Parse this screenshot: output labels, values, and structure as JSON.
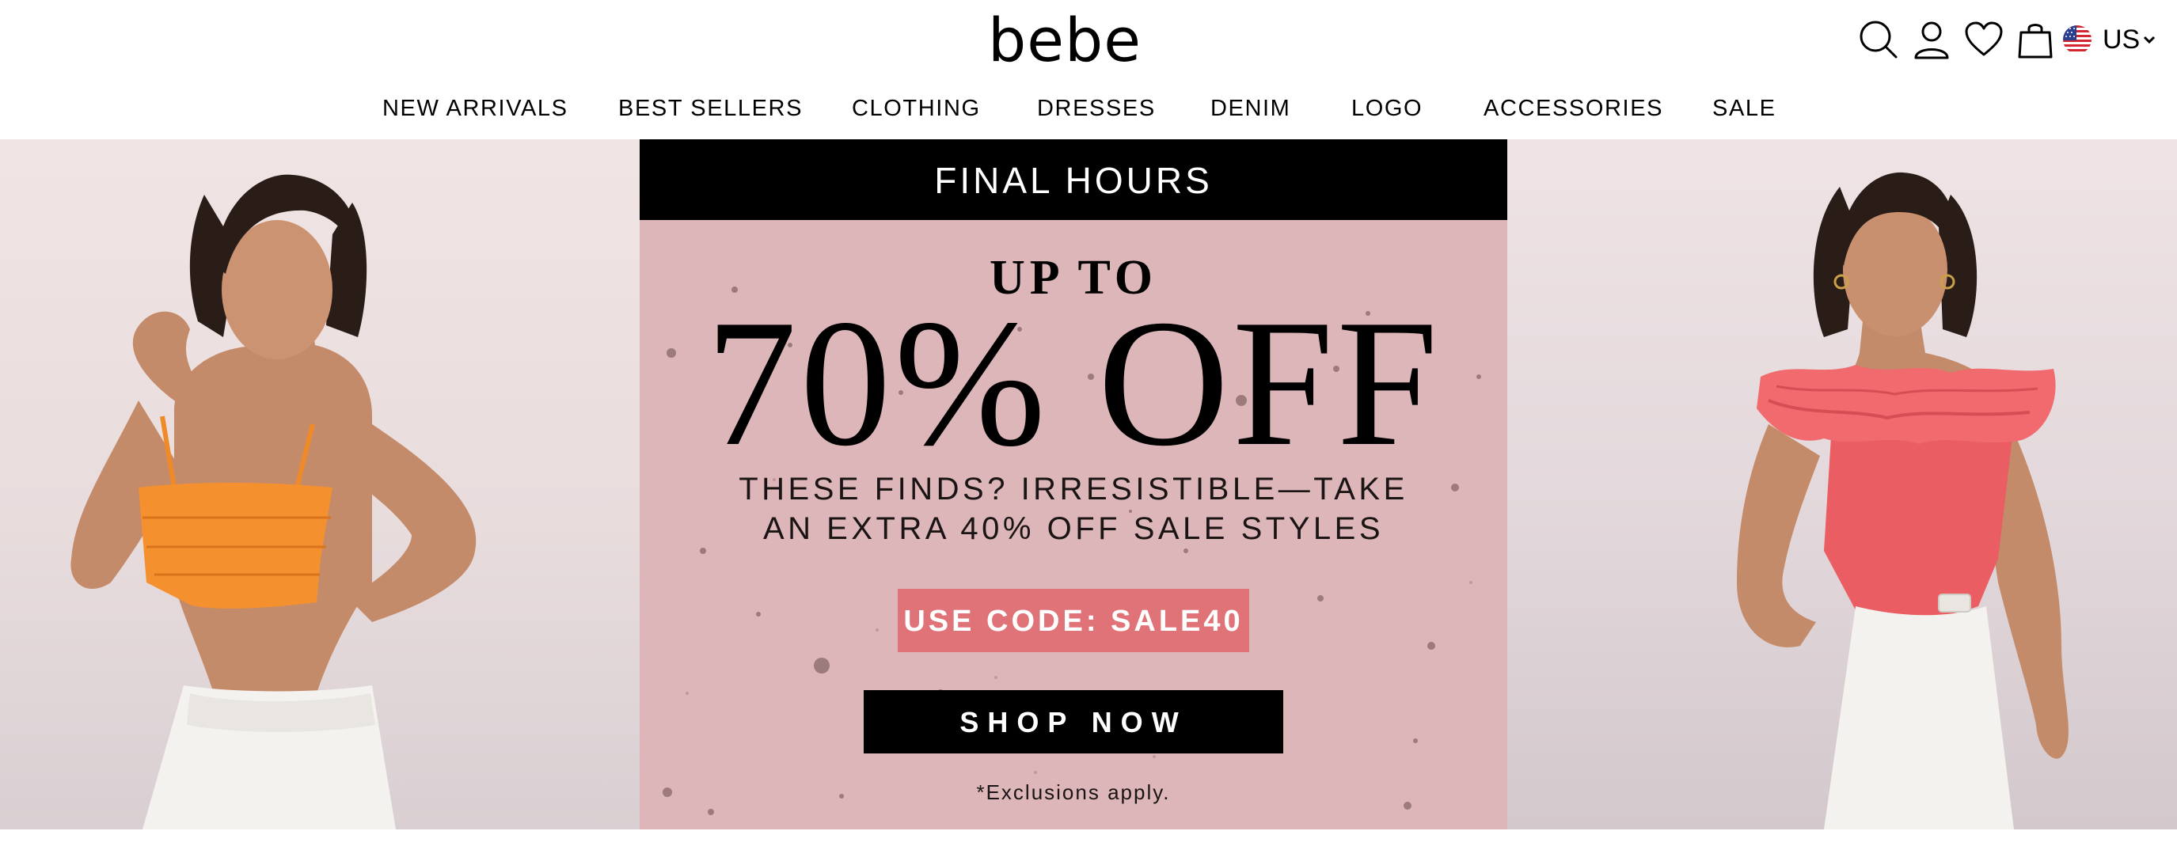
{
  "brand": {
    "logo_text": "bebe"
  },
  "header": {
    "icons": [
      "search-icon",
      "account-icon",
      "heart-icon",
      "bag-icon"
    ],
    "region": {
      "flag": "us-flag-icon",
      "label": "US"
    }
  },
  "nav": {
    "items": [
      "NEW ARRIVALS",
      "BEST SELLERS",
      "CLOTHING",
      "DRESSES",
      "DENIM",
      "LOGO",
      "ACCESSORIES",
      "SALE"
    ]
  },
  "promo": {
    "top_bar": "FINAL HOURS",
    "kicker": "UP TO",
    "headline": "70% OFF",
    "subtext_line1": "THESE FINDS? IRRESISTIBLE—TAKE",
    "subtext_line2": "AN EXTRA 40% OFF SALE STYLES",
    "code_label": "USE CODE: SALE40",
    "cta_label": "SHOP NOW",
    "disclaimer": "*Exclusions apply."
  },
  "colors": {
    "promo_background": "#dcb6b8",
    "code_box": "#e07377",
    "left_top": "#f5902f",
    "right_top": "#ea5d62"
  }
}
